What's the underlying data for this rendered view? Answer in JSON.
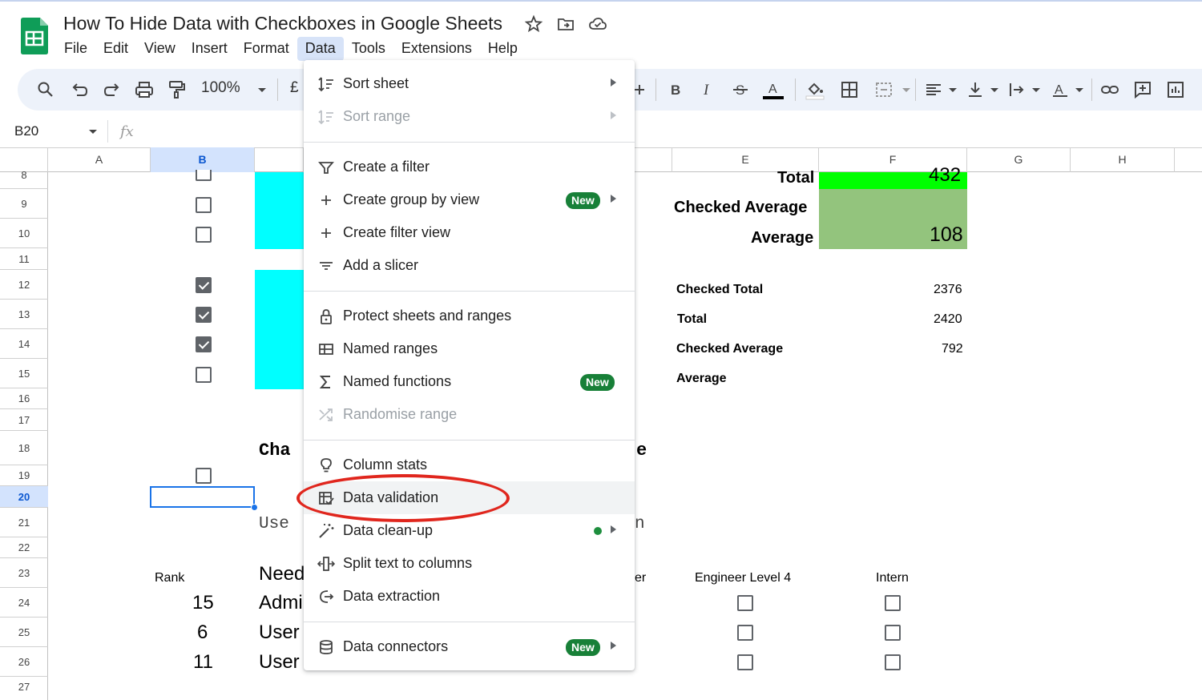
{
  "app": {
    "title": "How To Hide Data with Checkboxes in Google Sheets",
    "menu": [
      "File",
      "Edit",
      "View",
      "Insert",
      "Format",
      "Data",
      "Tools",
      "Extensions",
      "Help"
    ],
    "active_menu": "Data"
  },
  "toolbar": {
    "zoom": "100%",
    "currency": "£"
  },
  "formula_bar": {
    "name_box": "B20",
    "fx": "fx"
  },
  "columns": [
    "A",
    "B",
    "E",
    "F",
    "G",
    "H"
  ],
  "rows": [
    "8",
    "9",
    "10",
    "11",
    "12",
    "13",
    "14",
    "15",
    "16",
    "17",
    "18",
    "19",
    "20",
    "21",
    "22",
    "23",
    "24",
    "25",
    "26",
    "27"
  ],
  "sheet": {
    "total_label": "Total",
    "total_value": "432",
    "checked_avg_label": "Checked Average",
    "average_label": "Average",
    "average_value": "108",
    "summary": [
      {
        "label": "Checked Total",
        "value": "2376"
      },
      {
        "label": "Total",
        "value": "2420"
      },
      {
        "label": "Checked Average",
        "value": "792"
      },
      {
        "label": "Average",
        "value": ""
      }
    ],
    "heading_partial": "Cha",
    "heading_tail": "e",
    "use_partial": "Use",
    "use_tail": "n",
    "rank_header": "Rank",
    "need_partial": "Need",
    "er_partial": "er",
    "engineer_header": "Engineer Level 4",
    "intern_header": "Intern",
    "ranks": [
      "15",
      "6",
      "11"
    ],
    "names_partial": [
      "Admi",
      "User",
      "User"
    ]
  },
  "dropdown": {
    "items": [
      {
        "label": "Sort sheet",
        "icon": "sort-icon",
        "submenu": true
      },
      {
        "label": "Sort range",
        "icon": "sort-icon",
        "submenu": true,
        "disabled": true
      },
      {
        "label": "Create a filter",
        "icon": "filter-icon"
      },
      {
        "label": "Create group by view",
        "icon": "plus-icon",
        "badge": "New",
        "submenu": true
      },
      {
        "label": "Create filter view",
        "icon": "plus-icon"
      },
      {
        "label": "Add a slicer",
        "icon": "slicer-icon"
      },
      {
        "label": "Protect sheets and ranges",
        "icon": "lock-icon"
      },
      {
        "label": "Named ranges",
        "icon": "named-ranges-icon"
      },
      {
        "label": "Named functions",
        "icon": "sigma-icon",
        "badge": "New"
      },
      {
        "label": "Randomise range",
        "icon": "shuffle-icon",
        "disabled": true
      },
      {
        "label": "Column stats",
        "icon": "lightbulb-icon"
      },
      {
        "label": "Data validation",
        "icon": "data-validation-icon"
      },
      {
        "label": "Data clean-up",
        "icon": "magic-wand-icon",
        "submenu": true
      },
      {
        "label": "Split text to columns",
        "icon": "split-icon"
      },
      {
        "label": "Data extraction",
        "icon": "extraction-icon"
      },
      {
        "label": "Data connectors",
        "icon": "database-icon",
        "badge": "New",
        "submenu": true
      }
    ]
  },
  "colors": {
    "accent": "#1a73e8",
    "cyan": "#00ffff",
    "bright_green": "#00ff00",
    "soft_green": "#93c47d",
    "badge_green": "#188038",
    "annotation_red": "#e0261d"
  }
}
